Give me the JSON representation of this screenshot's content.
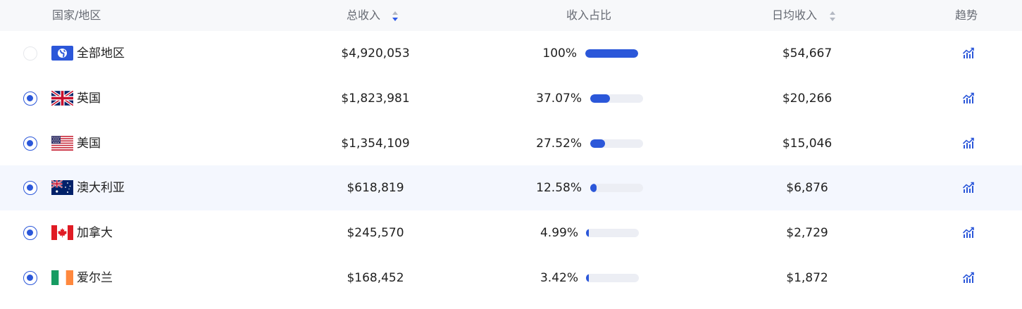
{
  "header": {
    "country": "国家/地区",
    "total": "总收入",
    "share": "收入占比",
    "daily": "日均收入",
    "trend": "趋势"
  },
  "sort": {
    "total": "descending",
    "daily": "none"
  },
  "colors": {
    "accent": "#2b57d9",
    "header_bg": "#f7f8fa",
    "bar_track": "#eceef4",
    "highlight_row": "#f4f7fe"
  },
  "rows": [
    {
      "flag": "globe-icon",
      "name": "全部地区",
      "selected": false,
      "total": "$4,920,053",
      "share": "100%",
      "share_value": 1.0,
      "daily": "$54,667",
      "highlighted": false
    },
    {
      "flag": "uk-flag-icon",
      "name": "英国",
      "selected": true,
      "total": "$1,823,981",
      "share": "37.07%",
      "share_value": 0.3707,
      "daily": "$20,266",
      "highlighted": false
    },
    {
      "flag": "us-flag-icon",
      "name": "美国",
      "selected": true,
      "total": "$1,354,109",
      "share": "27.52%",
      "share_value": 0.2752,
      "daily": "$15,046",
      "highlighted": false
    },
    {
      "flag": "australia-flag-icon",
      "name": "澳大利亚",
      "selected": true,
      "total": "$618,819",
      "share": "12.58%",
      "share_value": 0.1258,
      "daily": "$6,876",
      "highlighted": true
    },
    {
      "flag": "canada-flag-icon",
      "name": "加拿大",
      "selected": true,
      "total": "$245,570",
      "share": "4.99%",
      "share_value": 0.0499,
      "daily": "$2,729",
      "highlighted": false
    },
    {
      "flag": "ireland-flag-icon",
      "name": "爱尔兰",
      "selected": true,
      "total": "$168,452",
      "share": "3.42%",
      "share_value": 0.0342,
      "daily": "$1,872",
      "highlighted": false
    }
  ]
}
